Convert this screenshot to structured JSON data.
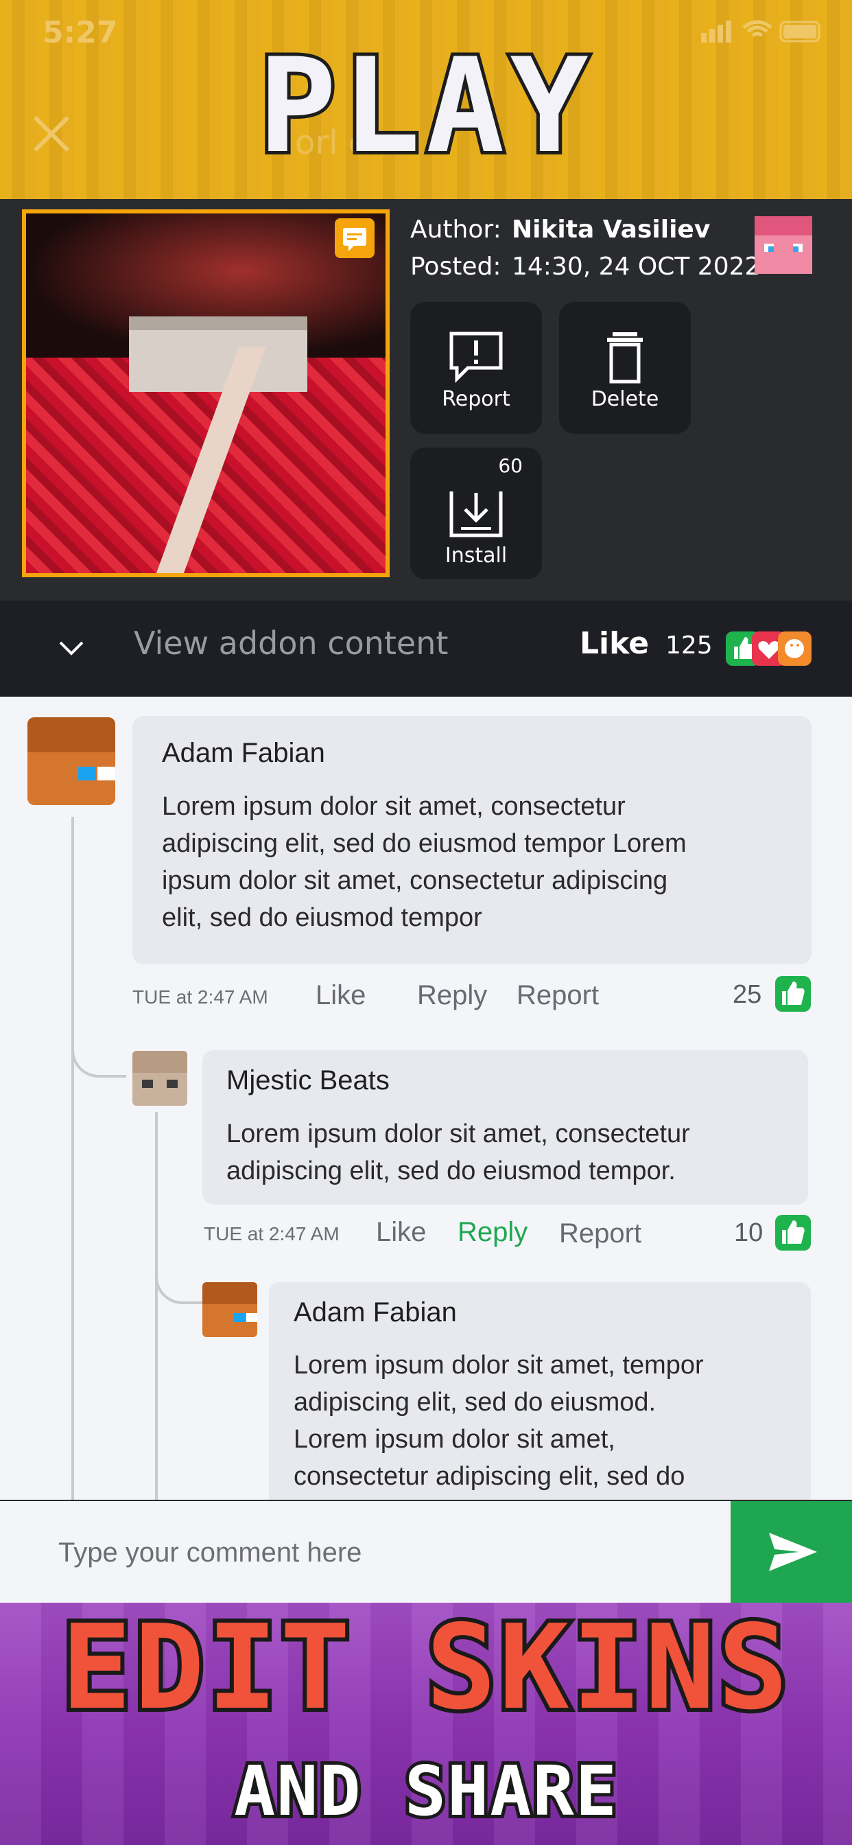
{
  "status_bar": {
    "time": "5:27"
  },
  "promo": {
    "top_text": "PLAY",
    "bottom_line1": "EDIT SKINS",
    "bottom_line2": "AND SHARE"
  },
  "header": {
    "faded_title": "orl            ers"
  },
  "addon": {
    "author_label": "Author:",
    "author_name": "Nikita Vasiliev",
    "posted_label": "Posted:",
    "posted_value": "14:30, 24 OCT 2022",
    "actions": {
      "report": "Report",
      "delete": "Delete",
      "install": "Install",
      "install_count": "60"
    },
    "view_text": "View addon content",
    "like_word": "Like",
    "like_count": "125"
  },
  "comments": [
    {
      "name": "Adam Fabian",
      "text_lines": [
        "Lorem ipsum dolor sit amet, consectetur",
        "adipiscing elit, sed do eiusmod tempor Lorem",
        "ipsum dolor sit amet, consectetur adipiscing",
        "elit, sed do eiusmod tempor"
      ],
      "time": "TUE at 2:47 AM",
      "like": "Like",
      "reply": "Reply",
      "report": "Report",
      "count": "25"
    },
    {
      "name": "Mjestic Beats",
      "text_lines": [
        "Lorem ipsum dolor sit amet, consectetur",
        "adipiscing elit, sed do eiusmod tempor."
      ],
      "time": "TUE at 2:47 AM",
      "like": "Like",
      "reply": "Reply",
      "report": "Report",
      "count": "10"
    },
    {
      "name": "Adam Fabian",
      "text_lines": [
        "Lorem ipsum dolor sit amet, tempor",
        "adipiscing elit, sed do eiusmod.",
        "Lorem ipsum dolor sit amet,",
        "consectetur adipiscing elit, sed do"
      ]
    }
  ],
  "input": {
    "placeholder": "Type your comment here"
  },
  "colors": {
    "accent_green": "#1fa651",
    "header_yellow": "#e8b11c",
    "dark_panel": "#2a2b2f",
    "promo_purple": "#8e34b3",
    "orange_border": "#f5a50b"
  }
}
